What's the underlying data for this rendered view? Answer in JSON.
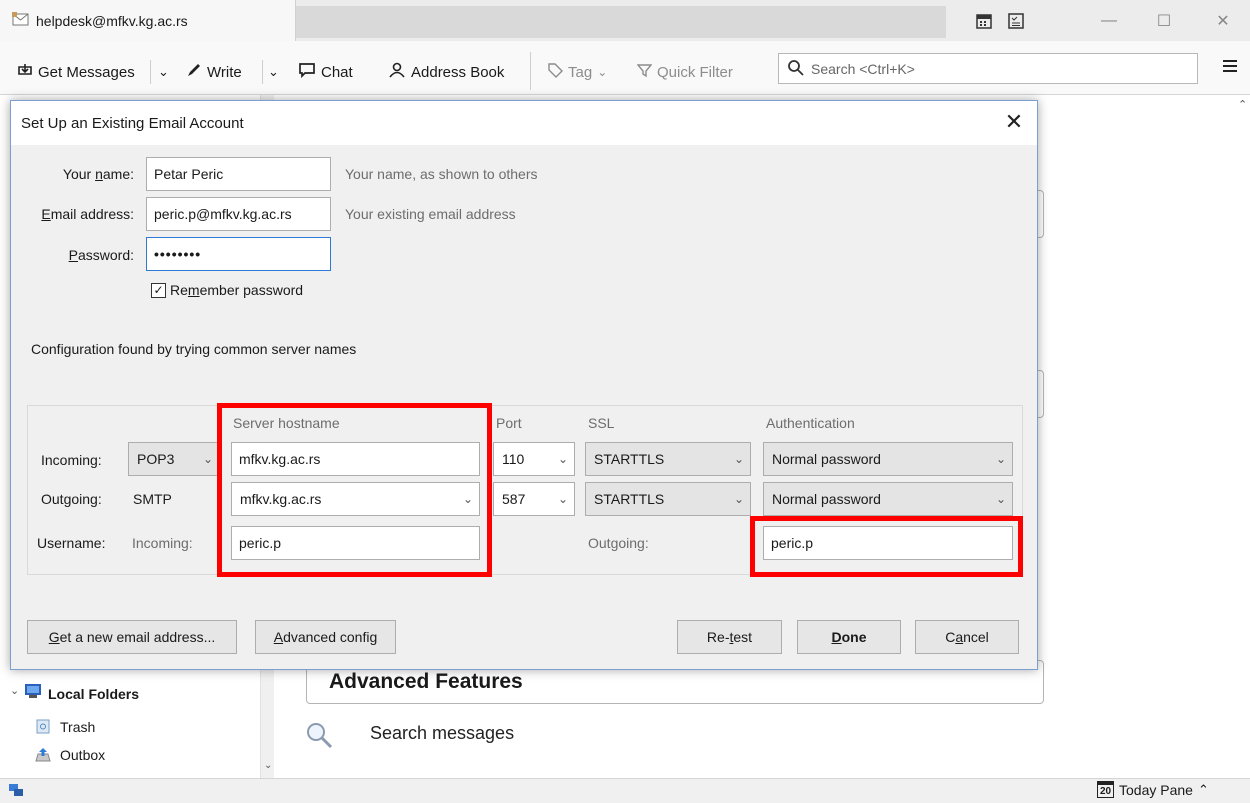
{
  "window": {
    "tab_title": "helpdesk@mfkv.kg.ac.rs"
  },
  "toolbar": {
    "get_messages": "Get Messages",
    "write": "Write",
    "chat": "Chat",
    "address_book": "Address Book",
    "tag": "Tag",
    "quick_filter": "Quick Filter",
    "search_placeholder": "Search <Ctrl+K>"
  },
  "sidebar": {
    "local_folders": "Local Folders",
    "trash": "Trash",
    "outbox": "Outbox"
  },
  "main": {
    "advanced_features": "Advanced Features",
    "search_messages": "Search messages"
  },
  "statusbar": {
    "today_pane": "Today Pane",
    "calendar_day": "20"
  },
  "dialog": {
    "title": "Set Up an Existing Email Account",
    "name_label_pre": "Your ",
    "name_label_u": "n",
    "name_label_post": "ame:",
    "name_value": "Petar Peric",
    "name_hint": "Your name, as shown to others",
    "email_label_u": "E",
    "email_label_post": "mail address:",
    "email_value": "peric.p@mfkv.kg.ac.rs",
    "email_hint": "Your existing email address",
    "password_label_u": "P",
    "password_label_post": "assword:",
    "password_value": "••••••••",
    "remember_pre": "Re",
    "remember_u": "m",
    "remember_post": "ember password",
    "remember_checked": true,
    "config_status": "Configuration found by trying common server names",
    "headers": {
      "hostname": "Server hostname",
      "port": "Port",
      "ssl": "SSL",
      "auth": "Authentication"
    },
    "incoming": {
      "label": "Incoming:",
      "protocol": "POP3",
      "hostname": "mfkv.kg.ac.rs",
      "port": "110",
      "ssl": "STARTTLS",
      "auth": "Normal password"
    },
    "outgoing": {
      "label": "Outgoing:",
      "protocol": "SMTP",
      "hostname": "mfkv.kg.ac.rs",
      "port": "587",
      "ssl": "STARTTLS",
      "auth": "Normal password"
    },
    "username": {
      "label": "Username:",
      "incoming_label": "Incoming:",
      "incoming_value": "peric.p",
      "outgoing_label": "Outgoing:",
      "outgoing_value": "peric.p"
    },
    "buttons": {
      "new_email_u": "G",
      "new_email_post": "et a new email address...",
      "advanced_u": "A",
      "advanced_post": "dvanced config",
      "retest_pre": "Re-",
      "retest_u": "t",
      "retest_post": "est",
      "done_u": "D",
      "done_post": "one",
      "cancel_pre": "C",
      "cancel_u": "a",
      "cancel_post": "ncel"
    }
  },
  "colors": {
    "highlight": "#ff0000",
    "focus": "#2c7ad6"
  }
}
